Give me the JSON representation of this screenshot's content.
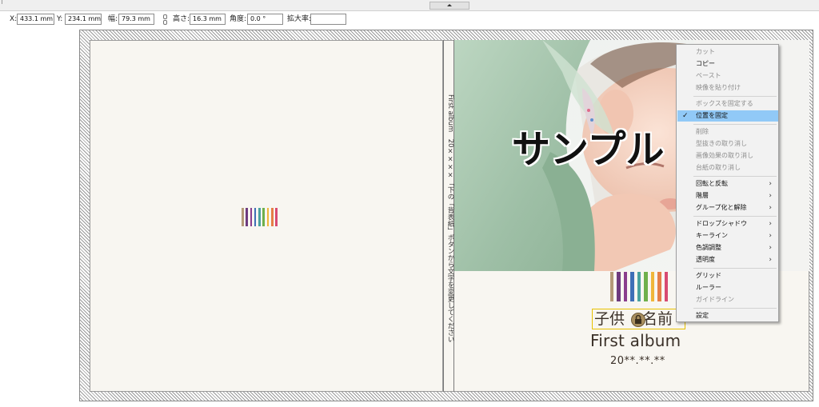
{
  "toolbar": {
    "x_label": "X:",
    "x_value": "433.1 mm",
    "y_label": "Y:",
    "y_value": "234.1 mm",
    "width_label": "幅:",
    "width_value": "79.3 mm",
    "height_label": "高さ:",
    "height_value": "16.3 mm",
    "angle_label": "角度:",
    "angle_value": "0.0 °",
    "scale_label": "拡大率:",
    "scale_value": ""
  },
  "spine": {
    "text": "First album　20××××「下の「背表紙」ボタンから文字を変更してください"
  },
  "cover": {
    "sample_text": "サンプル",
    "title_jp_part1": "子供",
    "title_jp_part2": "名前",
    "title_en": "First album",
    "date": "20**.**.**"
  },
  "stripe_colors": [
    "#b49a78",
    "#6e3b7e",
    "#8a3d8c",
    "#3f6fb7",
    "#4aa2a0",
    "#6fb04b",
    "#f0b63a",
    "#e57f47",
    "#d84a72"
  ],
  "context_menu": {
    "items": [
      {
        "label": "カット",
        "enabled": false
      },
      {
        "label": "コピー",
        "enabled": true
      },
      {
        "label": "ペースト",
        "enabled": false
      },
      {
        "label": "映像を貼り付け",
        "enabled": false
      },
      {
        "label": "ボックスを固定する",
        "enabled": false
      },
      {
        "label": "位置を固定",
        "enabled": true,
        "checked": true,
        "highlighted": true
      },
      {
        "label": "削除",
        "enabled": false
      },
      {
        "label": "型抜きの取り消し",
        "enabled": false
      },
      {
        "label": "画像効果の取り消し",
        "enabled": false
      },
      {
        "label": "台紙の取り消し",
        "enabled": false
      },
      {
        "label": "回転と反転",
        "enabled": true,
        "submenu": true
      },
      {
        "label": "階層",
        "enabled": true,
        "submenu": true
      },
      {
        "label": "グループ化と解除",
        "enabled": true,
        "submenu": true
      },
      {
        "label": "ドロップシャドウ",
        "enabled": true,
        "submenu": true
      },
      {
        "label": "キーライン",
        "enabled": true,
        "submenu": true
      },
      {
        "label": "色調調整",
        "enabled": true,
        "submenu": true
      },
      {
        "label": "透明度",
        "enabled": true,
        "submenu": true
      },
      {
        "label": "グリッド",
        "enabled": true
      },
      {
        "label": "ルーラー",
        "enabled": true
      },
      {
        "label": "ガイドライン",
        "enabled": false
      },
      {
        "label": "設定",
        "enabled": true
      }
    ]
  }
}
